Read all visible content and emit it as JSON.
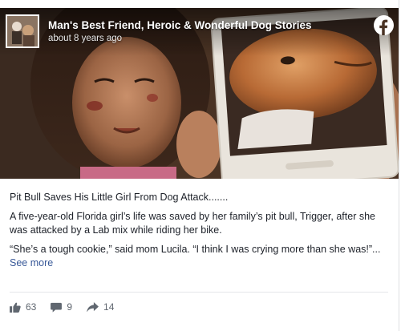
{
  "post": {
    "page_name": "Man's Best Friend, Heroic & Wonderful Dog Stories",
    "timestamp": "about 8 years ago",
    "title": "Pit Bull Saves His Little Girl From Dog Attack.......",
    "paragraph1": "A five-year-old Florida girl’s life was saved by her family’s pit bull, Trigger, after she was attacked by a Lab mix while riding her bike.",
    "paragraph2": "“She’s a tough cookie,” said mom Lucila. “I think I was crying more than she was!”...",
    "see_more": "See more"
  },
  "stats": {
    "likes": "63",
    "comments": "9",
    "shares": "14"
  },
  "icons": {
    "brand": "facebook-icon",
    "like": "thumbs-up-icon",
    "comment": "comment-bubble-icon",
    "share": "share-arrow-icon"
  },
  "colors": {
    "text": "#1d2129",
    "link": "#385898",
    "meta": "#606770",
    "divider": "#e5e6e9"
  }
}
